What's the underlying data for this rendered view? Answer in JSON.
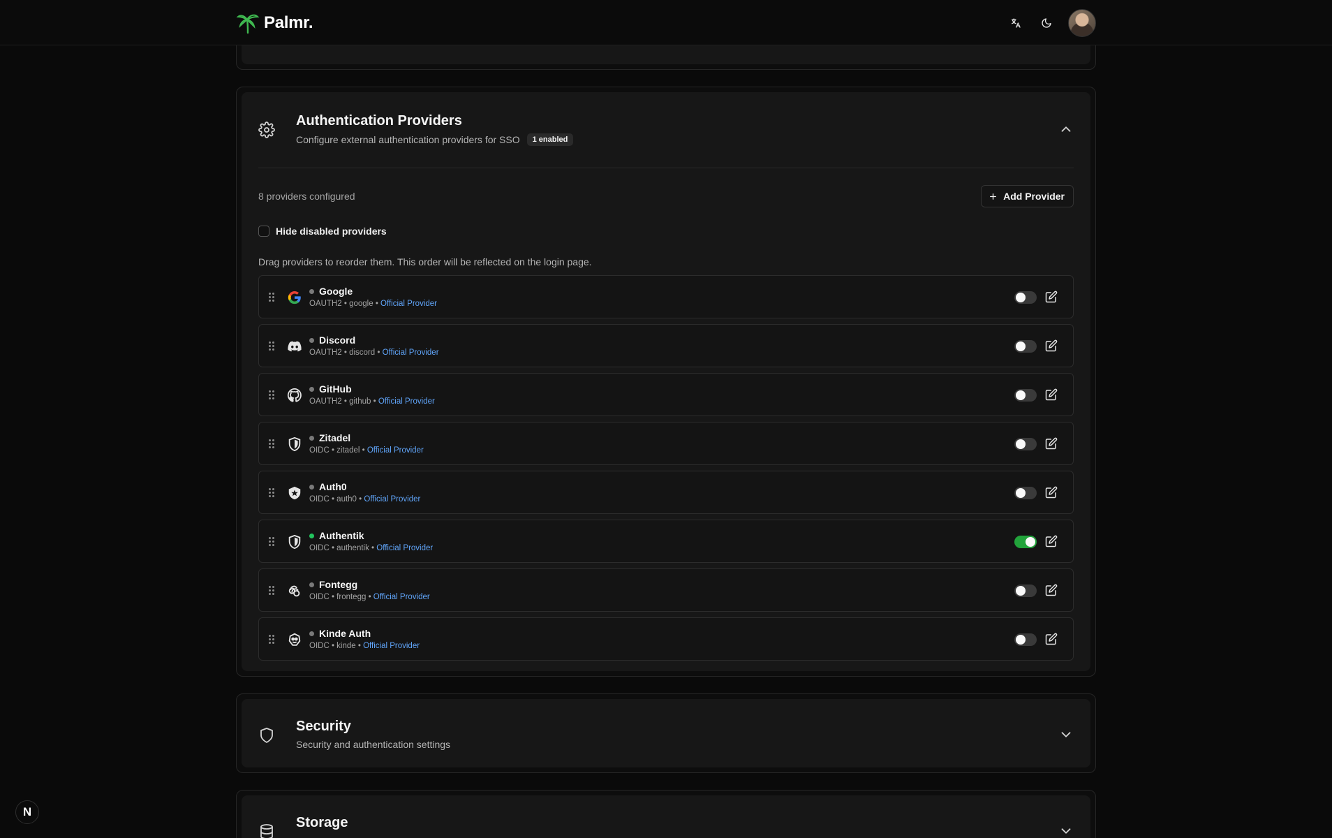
{
  "app": {
    "name": "Palmr."
  },
  "auth_card": {
    "title": "Authentication Providers",
    "description": "Configure external authentication providers for SSO",
    "badge": "1 enabled",
    "count_text": "8 providers configured",
    "add_button_label": "Add Provider",
    "hide_disabled_label": "Hide disabled providers",
    "hint": "Drag providers to reorder them. This order will be reflected on the login page.",
    "providers": [
      {
        "name": "Google",
        "protocol": "OAUTH2",
        "slug": "google",
        "tag": "Official Provider",
        "enabled": false,
        "icon": "google-icon"
      },
      {
        "name": "Discord",
        "protocol": "OAUTH2",
        "slug": "discord",
        "tag": "Official Provider",
        "enabled": false,
        "icon": "discord-icon"
      },
      {
        "name": "GitHub",
        "protocol": "OAUTH2",
        "slug": "github",
        "tag": "Official Provider",
        "enabled": false,
        "icon": "github-icon"
      },
      {
        "name": "Zitadel",
        "protocol": "OIDC",
        "slug": "zitadel",
        "tag": "Official Provider",
        "enabled": false,
        "icon": "shield-icon"
      },
      {
        "name": "Auth0",
        "protocol": "OIDC",
        "slug": "auth0",
        "tag": "Official Provider",
        "enabled": false,
        "icon": "auth0-icon"
      },
      {
        "name": "Authentik",
        "protocol": "OIDC",
        "slug": "authentik",
        "tag": "Official Provider",
        "enabled": true,
        "icon": "shield-icon"
      },
      {
        "name": "Fontegg",
        "protocol": "OIDC",
        "slug": "frontegg",
        "tag": "Official Provider",
        "enabled": false,
        "icon": "frontegg-icon"
      },
      {
        "name": "Kinde Auth",
        "protocol": "OIDC",
        "slug": "kinde",
        "tag": "Official Provider",
        "enabled": false,
        "icon": "kinde-icon"
      }
    ]
  },
  "security_card": {
    "title": "Security",
    "description": "Security and authentication settings"
  },
  "storage_card": {
    "title": "Storage"
  },
  "colors": {
    "background": "#0a0a0a",
    "card": "#171717",
    "accent_link": "#60a5fa",
    "enabled_green": "#22a33b"
  }
}
